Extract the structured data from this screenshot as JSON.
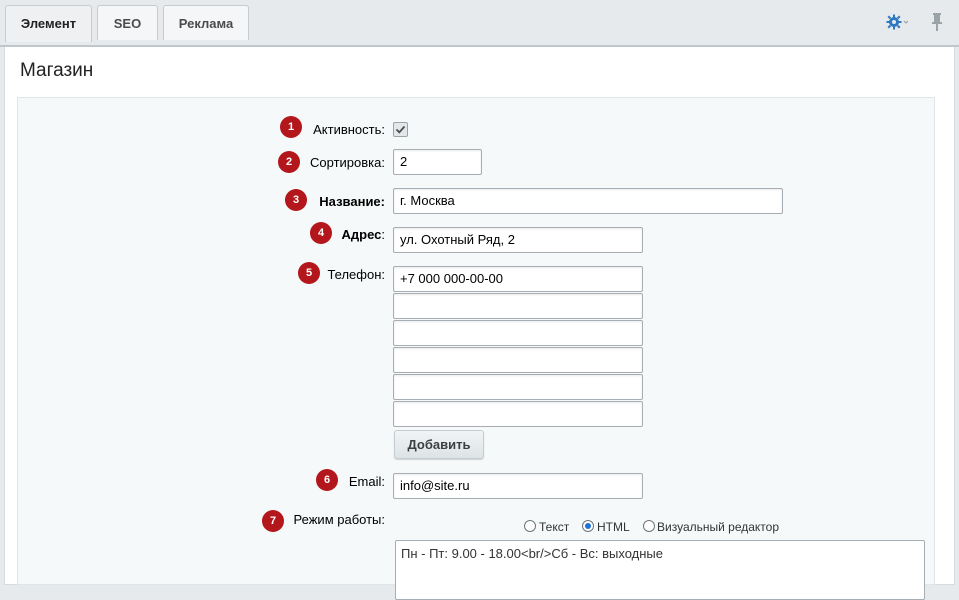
{
  "tabs": [
    {
      "label": "Элемент",
      "active": true
    },
    {
      "label": "SEO",
      "active": false
    },
    {
      "label": "Реклама",
      "active": false
    }
  ],
  "icons": {
    "settings": "gear-icon",
    "pin": "pin-icon"
  },
  "colors": {
    "accent": "#1a73d9",
    "badge": "#b3171b",
    "gear": "#2e78c2"
  },
  "panel": {
    "title": "Магазин"
  },
  "badges": [
    "1",
    "2",
    "3",
    "4",
    "5",
    "6",
    "7"
  ],
  "form": {
    "active": {
      "label": "Активность:",
      "checked": true
    },
    "sort": {
      "label": "Сортировка:",
      "value": "2"
    },
    "name": {
      "label": "Название:",
      "value": "г. Москва"
    },
    "address": {
      "label_main": "Адрес",
      "label_suffix": ":",
      "value": "ул. Охотный Ряд, 2"
    },
    "phone": {
      "label": "Телефон:",
      "values": [
        "+7 000 000-00-00",
        "",
        "",
        "",
        "",
        ""
      ],
      "add_button": "Добавить"
    },
    "email": {
      "label": "Email:",
      "value": "info@site.ru"
    },
    "schedule": {
      "label": "Режим работы:",
      "modes": [
        {
          "label": "Текст",
          "checked": false
        },
        {
          "label": "HTML",
          "checked": true
        },
        {
          "label": "Визуальный редактор",
          "checked": false
        }
      ],
      "value": "Пн - Пт: 9.00 - 18.00<br/>Сб - Вс: выходные"
    }
  }
}
